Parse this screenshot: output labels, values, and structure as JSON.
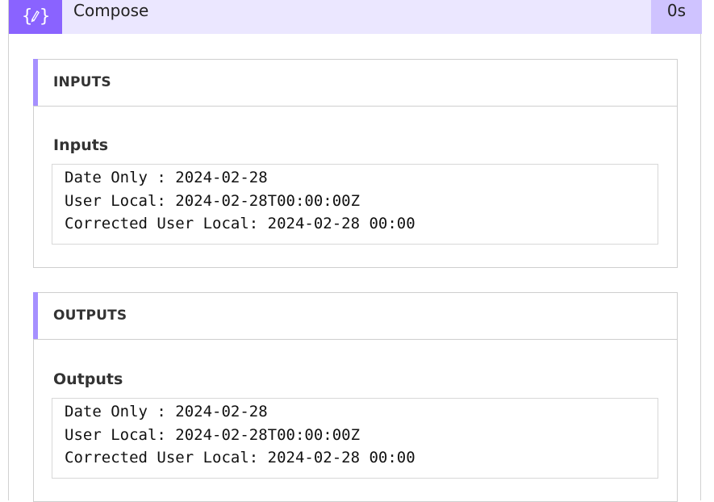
{
  "header": {
    "title": "Compose",
    "duration": "0s",
    "icon": "compose-braces-icon",
    "icon_bg": "#8a63ff",
    "header_bg": "#ebe7ff",
    "duration_bg": "#cfc3ff"
  },
  "inputs": {
    "section_title": "INPUTS",
    "label": "Inputs",
    "lines": [
      "Date Only : 2024-02-28",
      "User Local: 2024-02-28T00:00:00Z",
      "Corrected User Local: 2024-02-28 00:00"
    ]
  },
  "outputs": {
    "section_title": "OUTPUTS",
    "label": "Outputs",
    "lines": [
      "Date Only : 2024-02-28",
      "User Local: 2024-02-28T00:00:00Z",
      "Corrected User Local: 2024-02-28 00:00"
    ]
  },
  "accent_color": "#a690ff"
}
